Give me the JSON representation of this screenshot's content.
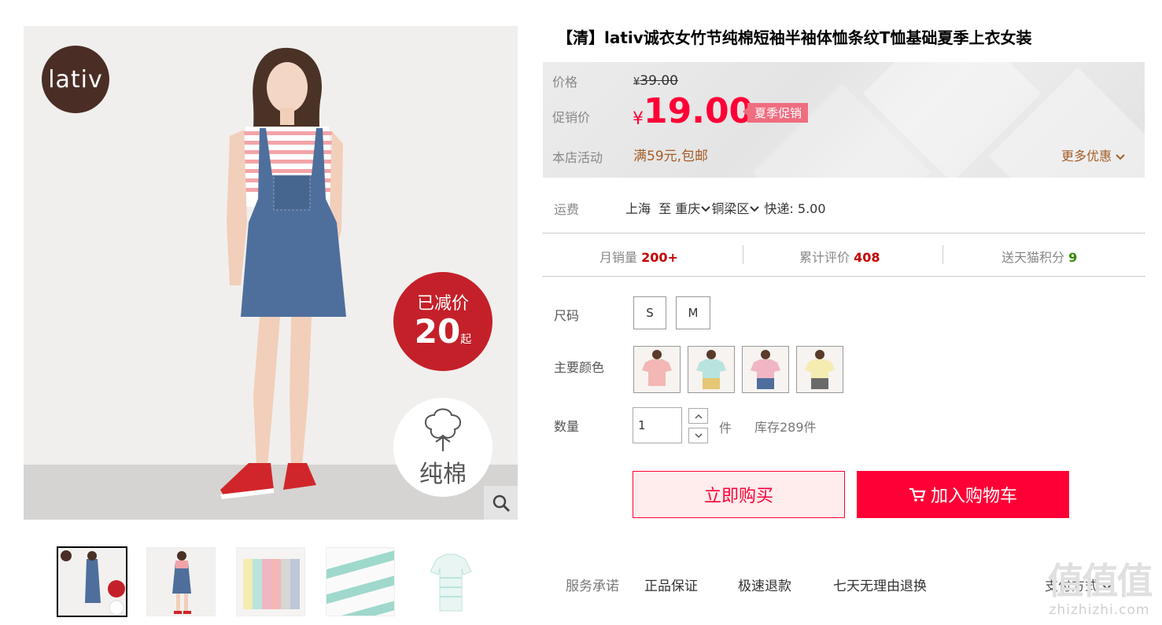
{
  "brand": {
    "logo_text": "lativ"
  },
  "badges": {
    "discount_line1": "已减价",
    "discount_amount": "20",
    "discount_suffix": "起",
    "cotton_label": "纯棉"
  },
  "product": {
    "title": "【清】lativ诚衣女竹节纯棉短袖半袖体恤条纹T恤基础夏季上衣女装"
  },
  "price": {
    "label": "价格",
    "currency": "¥",
    "original": "39.00",
    "promo_label": "促销价",
    "promo": "19.00",
    "promo_tag": "夏季促销",
    "shop_activity_label": "本店活动",
    "shop_activity": "满59元,包邮",
    "more_offers": "更多优惠"
  },
  "shipping": {
    "label": "运费",
    "from": "上海",
    "to_word": "至",
    "city": "重庆",
    "district": "铜梁区",
    "method": "快递: 5.00"
  },
  "stats": [
    {
      "label": "月销量",
      "value": "200+"
    },
    {
      "label": "累计评价",
      "value": "408"
    },
    {
      "label": "送天猫积分",
      "value": "9"
    }
  ],
  "sizes": {
    "label": "尺码",
    "options": [
      "S",
      "M"
    ]
  },
  "colors": {
    "label": "主要颜色",
    "swatch_colors": [
      "#f3b7b5",
      "#b9e4dd",
      "#f1b6c3",
      "#f4ecb0"
    ]
  },
  "quantity": {
    "label": "数量",
    "value": "1",
    "unit": "件",
    "stock": "库存289件"
  },
  "actions": {
    "buy_now": "立即购买",
    "add_to_cart": "加入购物车"
  },
  "services": {
    "label": "服务承诺",
    "items": [
      "正品保证",
      "极速退款",
      "七天无理由退换"
    ],
    "payment": "支付方式"
  },
  "watermark": {
    "big": "值值值",
    "small": "zhizhizhi.com"
  },
  "colors_theme": {
    "accent": "#ff0036",
    "promo_tag": "#ef6d7f",
    "activity": "#a55c27"
  }
}
